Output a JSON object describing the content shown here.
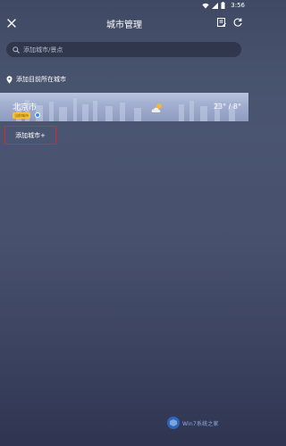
{
  "status_bar": {
    "time": "3:56"
  },
  "header": {
    "title": "城市管理"
  },
  "search": {
    "placeholder": "添加城市/景点"
  },
  "location": {
    "label": "添加目前所在城市"
  },
  "city_card": {
    "name": "北京市",
    "badge": "当前城市",
    "temperature": "23° / 8°"
  },
  "add_city": {
    "label": "添加城市+"
  },
  "watermark": {
    "text": "Win7系统之家"
  },
  "colors": {
    "highlight": "#e0262c",
    "badge": "#f5c33b"
  }
}
